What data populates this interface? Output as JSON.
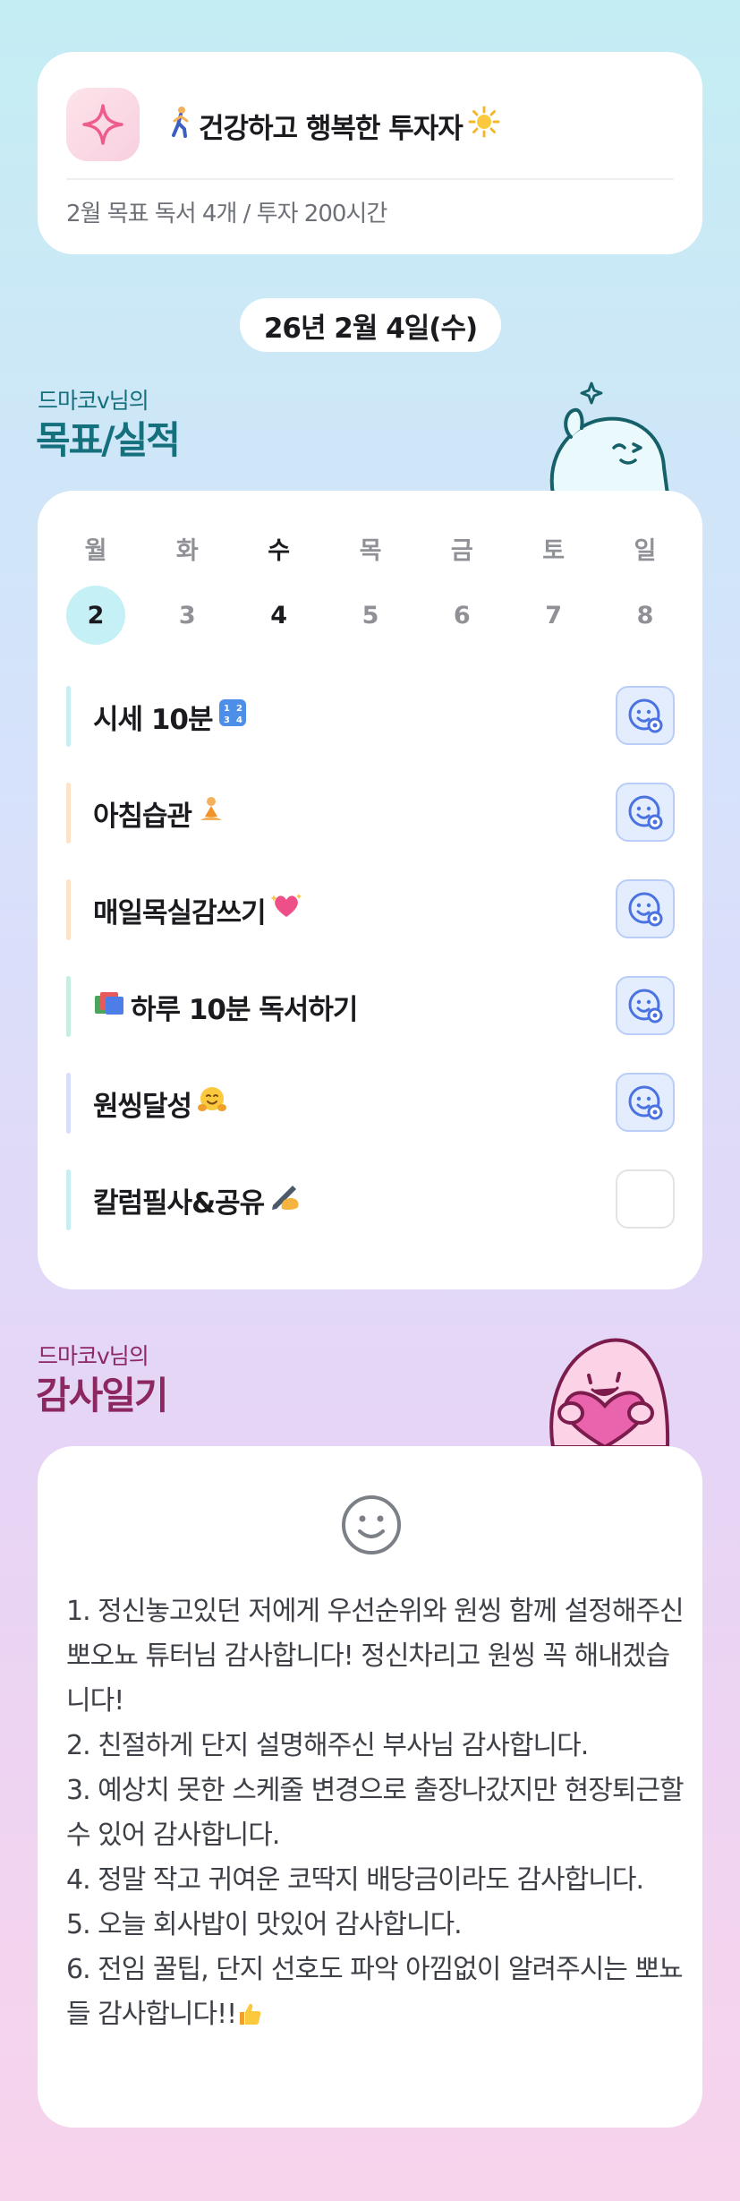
{
  "profile": {
    "title": "건강하고 행복한 투자자",
    "goal": "2월 목표  독서 4개 / 투자 200시간"
  },
  "date": "26년 2월 4일(수)",
  "goals_section": {
    "subtitle": "드마코v님의",
    "title": "목표/실적"
  },
  "week": {
    "days": [
      "월",
      "화",
      "수",
      "목",
      "금",
      "토",
      "일"
    ],
    "dates": [
      "2",
      "3",
      "4",
      "5",
      "6",
      "7",
      "8"
    ]
  },
  "habits": [
    {
      "label": "시세 10분",
      "bar_color": "#c7eef3",
      "done": true
    },
    {
      "label": "아침습관",
      "bar_color": "#fde3c8",
      "done": true
    },
    {
      "label": "매일목실감쓰기",
      "bar_color": "#fde3c8",
      "done": true
    },
    {
      "label": "하루 10분 독서하기",
      "bar_color": "#c7efe0",
      "done": true
    },
    {
      "label": "원씽달성",
      "bar_color": "#d7defb",
      "done": true
    },
    {
      "label": "칼럼필사&공유",
      "bar_color": "#c7eef3",
      "done": false
    }
  ],
  "gratitude_section": {
    "subtitle": "드마코v님의",
    "title": "감사일기"
  },
  "journal": "1. 정신놓고있던 저에게 우선순위와 원씽 함께 설정해주신 뽀오뇨 튜터님 감사합니다! 정신차리고 원씽 꼭 해내겠습니다!\n2. 친절하게 단지 설명해주신 부사님 감사합니다.\n3. 예상치 못한 스케줄 변경으로 출장나갔지만 현장퇴근할 수 있어 감사합니다.\n4. 정말 작고 귀여운 코딱지 배당금이라도 감사합니다.\n5. 오늘 회사밥이 맛있어 감사합니다.\n6. 전임 꿀팁, 단지 선호도 파악 아낌없이 알려주시는 뽀뇨들 감사합니다!!",
  "icons": {
    "profile": "sparkle-icon",
    "checked": "smile-check-icon",
    "journal_mood": "smile-icon"
  },
  "colors": {
    "teal_title": "#14707c",
    "berry_title": "#8c2761",
    "check_blue": "#4a72e0"
  }
}
